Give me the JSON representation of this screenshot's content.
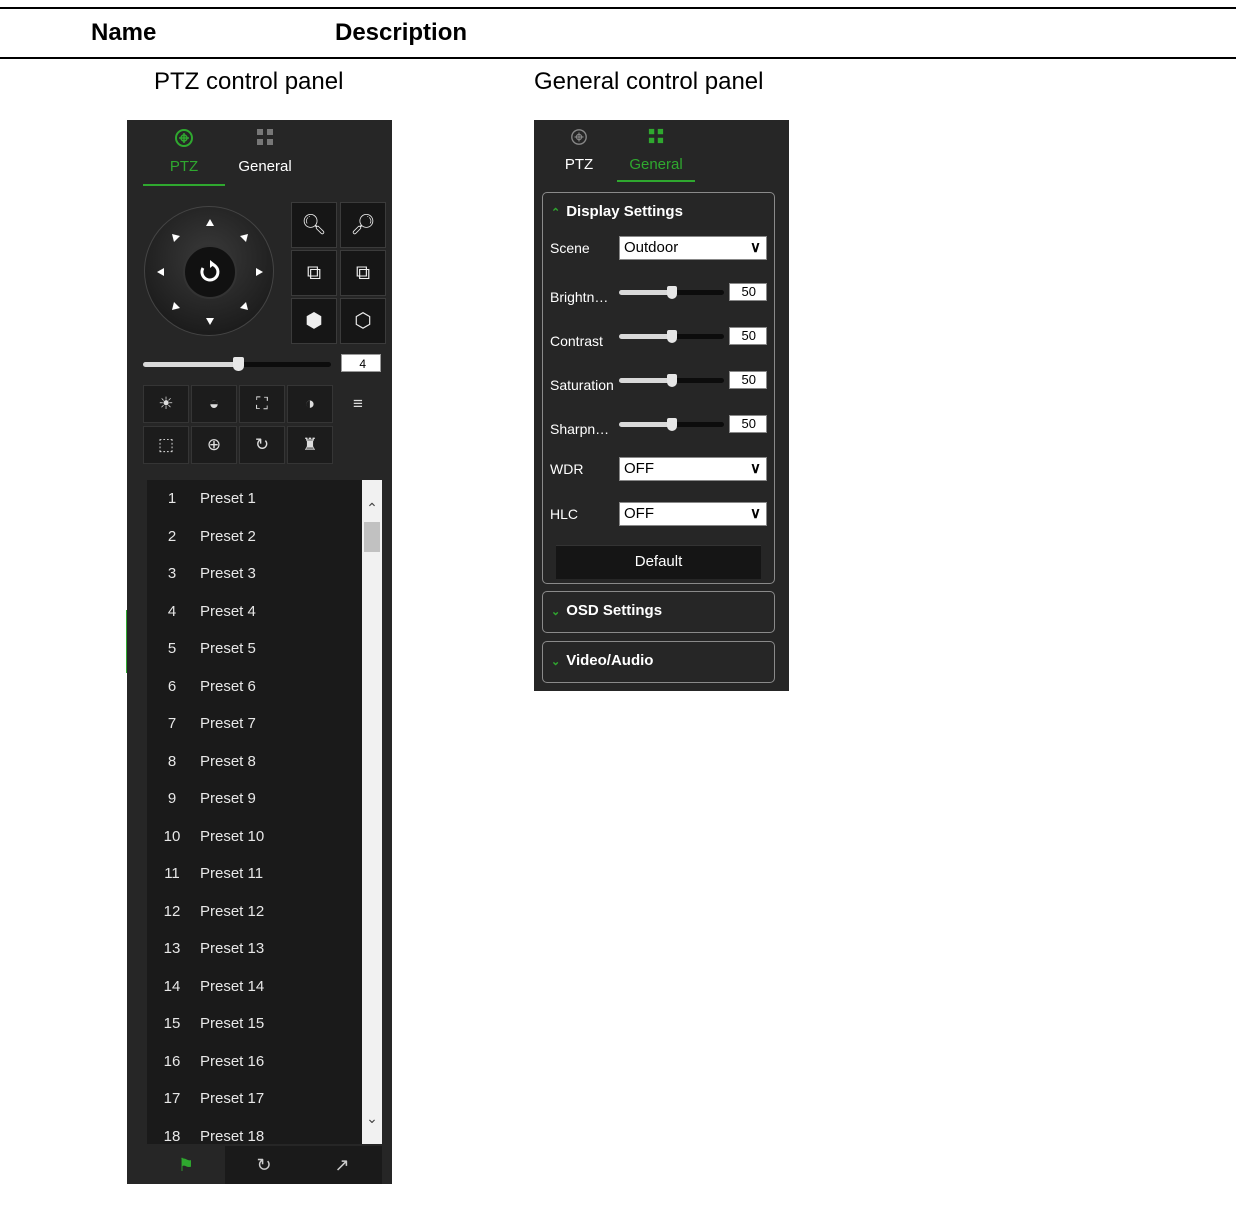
{
  "table": {
    "col_name": "Name",
    "col_description": "Description"
  },
  "captions": {
    "ptz": "PTZ control panel",
    "general": "General control panel"
  },
  "ptz_panel": {
    "tabs": [
      {
        "label": "PTZ",
        "icon": "ptz-crosshair-icon",
        "active": true
      },
      {
        "label": "General",
        "icon": "grid-icon",
        "active": false
      }
    ],
    "speed_value": "4",
    "presets": [
      {
        "num": "1",
        "name": "Preset 1"
      },
      {
        "num": "2",
        "name": "Preset 2"
      },
      {
        "num": "3",
        "name": "Preset 3"
      },
      {
        "num": "4",
        "name": "Preset 4"
      },
      {
        "num": "5",
        "name": "Preset 5"
      },
      {
        "num": "6",
        "name": "Preset 6"
      },
      {
        "num": "7",
        "name": "Preset 7"
      },
      {
        "num": "8",
        "name": "Preset 8"
      },
      {
        "num": "9",
        "name": "Preset 9"
      },
      {
        "num": "10",
        "name": "Preset 10"
      },
      {
        "num": "11",
        "name": "Preset 11"
      },
      {
        "num": "12",
        "name": "Preset 12"
      },
      {
        "num": "13",
        "name": "Preset 13"
      },
      {
        "num": "14",
        "name": "Preset 14"
      },
      {
        "num": "15",
        "name": "Preset 15"
      },
      {
        "num": "16",
        "name": "Preset 16"
      },
      {
        "num": "17",
        "name": "Preset 17"
      },
      {
        "num": "18",
        "name": "Preset 18"
      }
    ]
  },
  "general_panel": {
    "tabs": [
      {
        "label": "PTZ",
        "icon": "ptz-crosshair-icon",
        "active": false
      },
      {
        "label": "General",
        "icon": "grid-icon",
        "active": true
      }
    ],
    "display_settings": {
      "title": "Display Settings",
      "scene_label": "Scene",
      "scene_value": "Outdoor",
      "sliders": [
        {
          "label": "Brightn…",
          "value": "50",
          "level": 50
        },
        {
          "label": "Contrast",
          "value": "50",
          "level": 50
        },
        {
          "label": "Saturation",
          "value": "50",
          "level": 50
        },
        {
          "label": "Sharpn…",
          "value": "50",
          "level": 50
        }
      ],
      "wdr_label": "WDR",
      "wdr_value": "OFF",
      "hlc_label": "HLC",
      "hlc_value": "OFF",
      "default_button": "Default"
    },
    "osd_settings": {
      "title": "OSD Settings"
    },
    "video_audio": {
      "title": "Video/Audio"
    }
  },
  "colors": {
    "panel_bg": "#262626",
    "accent_green": "#2fa82f"
  }
}
